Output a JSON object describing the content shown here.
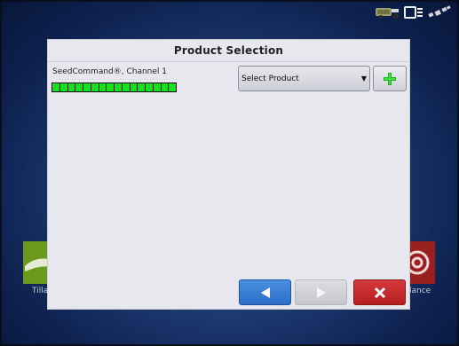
{
  "dialog": {
    "title": "Product Selection",
    "channel_label": "SeedCommand®, Channel 1",
    "progress_segments": 16,
    "select": {
      "value": "Select Product"
    }
  },
  "background": {
    "left_tile_label": "Tilla",
    "right_tile_label": "lance"
  },
  "colors": {
    "accent_blue": "#2b6ec7",
    "cancel_red": "#b51e22",
    "progress_green": "#18e21b",
    "left_tile_green": "#6b9a1d",
    "right_tile_red": "#9a1f1f"
  },
  "icons": {
    "status": [
      "tractor-implement-icon",
      "display-icon",
      "gps-signal-icon"
    ],
    "add": "plus-icon",
    "back": "arrow-left-icon",
    "next": "arrow-right-icon",
    "cancel": "close-icon"
  }
}
